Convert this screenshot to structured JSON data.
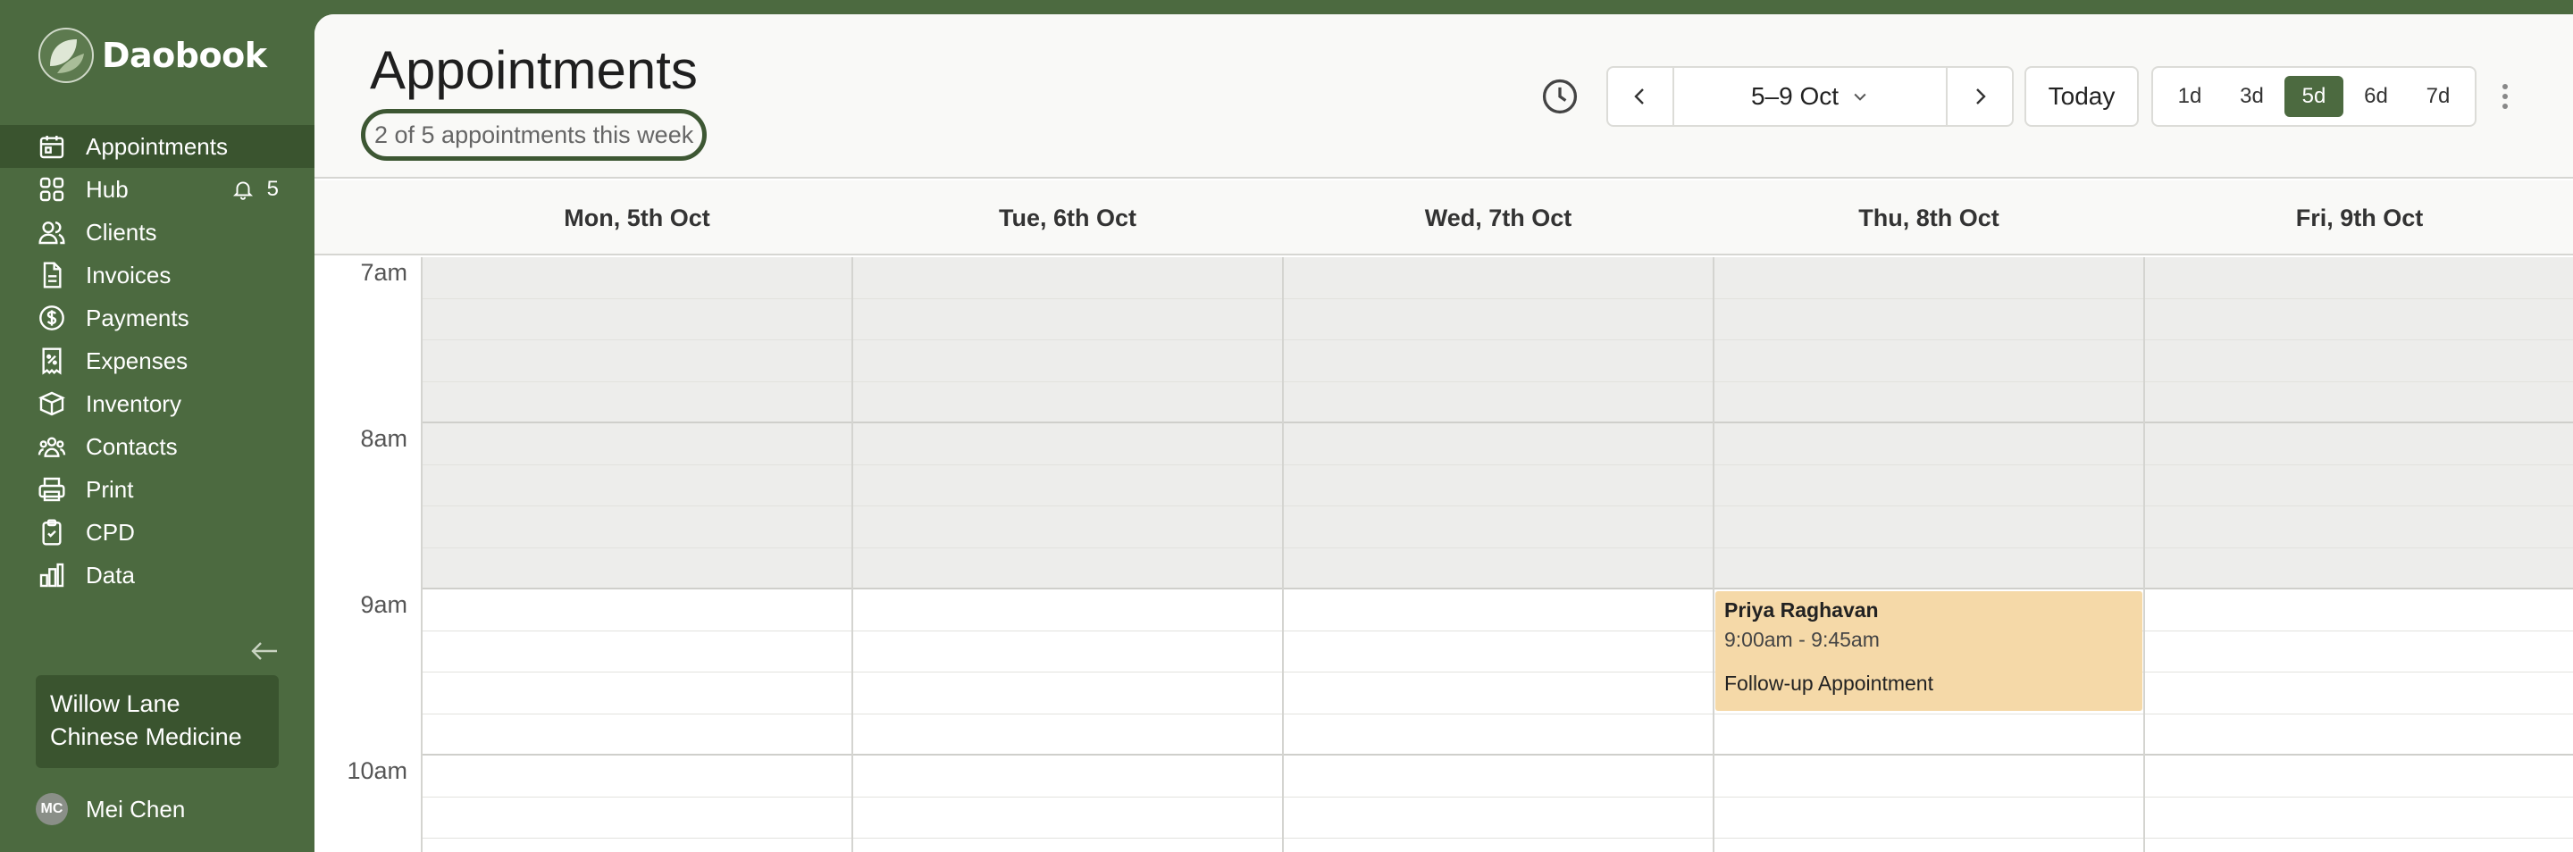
{
  "app": {
    "name": "Daobook",
    "accent": "#4c6a40"
  },
  "sidebar": {
    "items": [
      {
        "label": "Appointments",
        "icon": "calendar-icon"
      },
      {
        "label": "Hub",
        "icon": "grid-icon",
        "badge": "5",
        "badge_icon": "bell-icon"
      },
      {
        "label": "Clients",
        "icon": "users-icon"
      },
      {
        "label": "Invoices",
        "icon": "document-icon"
      },
      {
        "label": "Payments",
        "icon": "dollar-icon"
      },
      {
        "label": "Expenses",
        "icon": "receipt-icon"
      },
      {
        "label": "Inventory",
        "icon": "box-icon"
      },
      {
        "label": "Contacts",
        "icon": "contacts-icon"
      },
      {
        "label": "Print",
        "icon": "printer-icon"
      },
      {
        "label": "CPD",
        "icon": "clipboard-check-icon"
      },
      {
        "label": "Data",
        "icon": "bar-chart-icon"
      }
    ],
    "practice_line1": "Willow Lane",
    "practice_line2": "Chinese Medicine",
    "user_initials": "MC",
    "user_name": "Mei Chen"
  },
  "header": {
    "title": "Appointments",
    "week_summary": "2 of 5 appointments this week",
    "date_range": "5–9 Oct",
    "today_label": "Today",
    "views": [
      "1d",
      "3d",
      "5d",
      "6d",
      "7d"
    ],
    "active_view": "5d"
  },
  "calendar": {
    "days": [
      "Mon, 5th Oct",
      "Tue, 6th Oct",
      "Wed, 7th Oct",
      "Thu, 8th Oct",
      "Fri, 9th Oct"
    ],
    "hours": [
      "7am",
      "8am",
      "9am",
      "10am"
    ],
    "appointments": [
      {
        "client": "Priya Raghavan",
        "time": "9:00am - 9:45am",
        "type": "Follow-up Appointment",
        "day": "Thu, 8th Oct",
        "color": "#f5d9a8"
      }
    ]
  }
}
